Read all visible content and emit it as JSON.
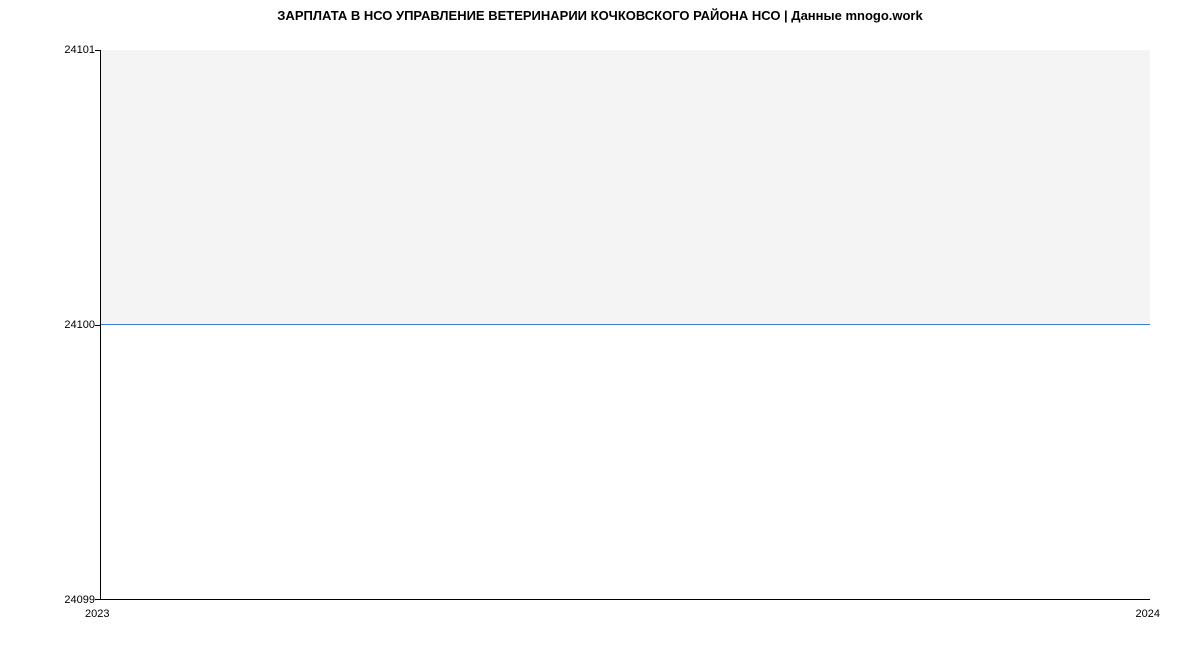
{
  "chart_data": {
    "type": "line",
    "title": "ЗАРПЛАТА В НСО УПРАВЛЕНИЕ ВЕТЕРИНАРИИ КОЧКОВСКОГО РАЙОНА НСО | Данные mnogo.work",
    "x": [
      "2023",
      "2024"
    ],
    "values": [
      24100,
      24100
    ],
    "xlabel": "",
    "ylabel": "",
    "ylim": [
      24099,
      24101
    ],
    "y_ticks": [
      "24101",
      "24100",
      "24099"
    ],
    "x_ticks": [
      "2023",
      "2024"
    ],
    "line_color": "#3b7dd8"
  }
}
